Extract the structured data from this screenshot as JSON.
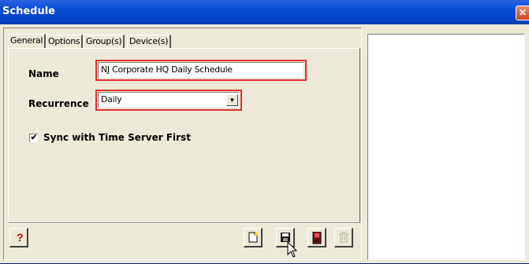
{
  "window": {
    "title": "Schedule",
    "close_glyph": "✕"
  },
  "tabs": [
    {
      "label": "General",
      "active": true
    },
    {
      "label": "Options",
      "active": false
    },
    {
      "label": "Group(s)",
      "active": false
    },
    {
      "label": "Device(s)",
      "active": false
    }
  ],
  "form": {
    "name_label": "Name",
    "name_value": "NJ Corporate HQ Daily Schedule",
    "recurrence_label": "Recurrence",
    "recurrence_value": "Daily",
    "sync_label": "Sync with Time Server First",
    "sync_checked": true,
    "sync_glyph": "✔"
  },
  "toolbar": {
    "help_glyph": "?",
    "icons": [
      "help-icon",
      "new-icon",
      "save-icon",
      "exit-icon",
      "delete-icon"
    ]
  },
  "colors": {
    "highlight": "#e03030",
    "titlebar": "#0a4fd8"
  }
}
